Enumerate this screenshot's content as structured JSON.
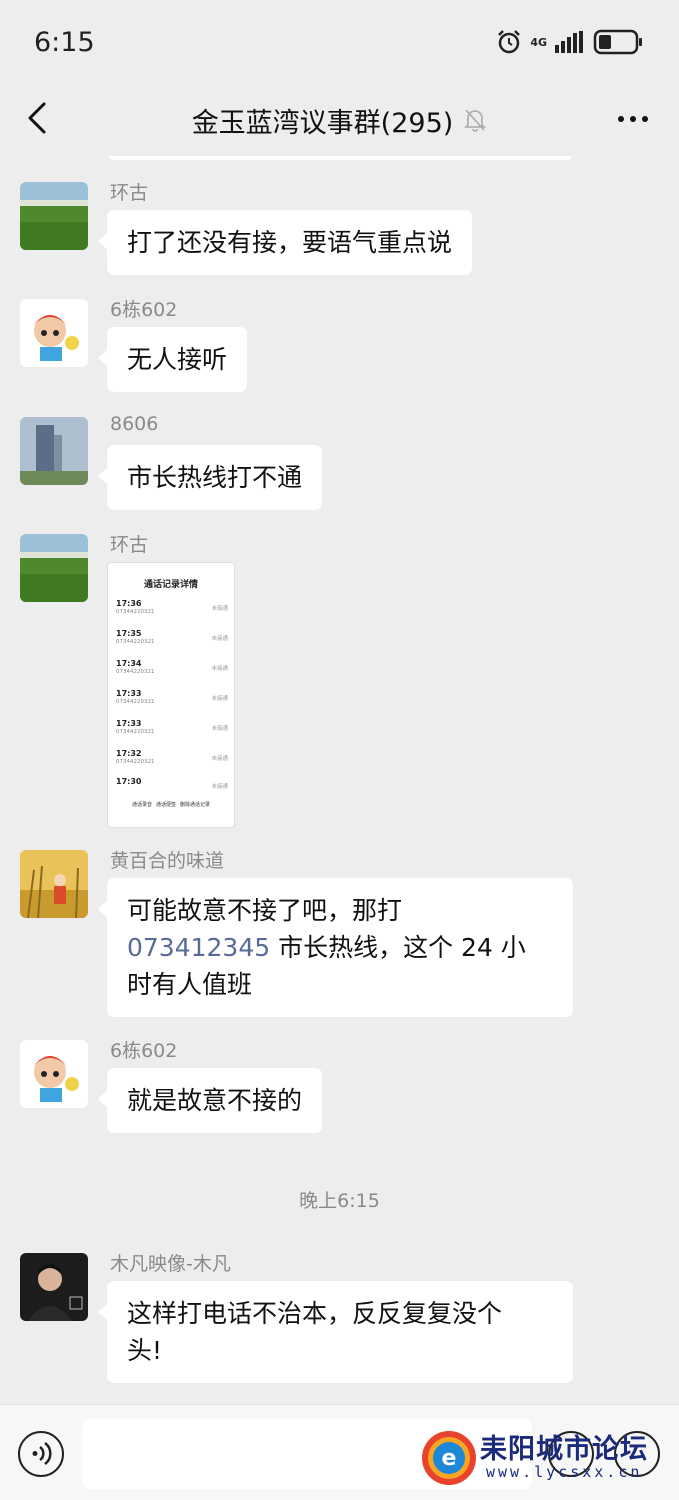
{
  "status": {
    "time": "6:15",
    "network": "4G"
  },
  "header": {
    "title": "金玉蓝湾议事群(295)"
  },
  "messages": [
    {
      "sender": "环古",
      "text": "打了还没有接，要语气重点说"
    },
    {
      "sender": "6栋602",
      "text": "无人接听"
    },
    {
      "sender": "8606",
      "text": "市长热线打不通"
    },
    {
      "sender": "环古",
      "image": {
        "title": "通话记录详情",
        "rows": [
          {
            "time": "17:36",
            "number": "07344220321",
            "status": "未接通"
          },
          {
            "time": "17:35",
            "number": "07344220321",
            "status": "未接通"
          },
          {
            "time": "17:34",
            "number": "07344220321",
            "status": "未接通"
          },
          {
            "time": "17:33",
            "number": "07344220321",
            "status": "未接通"
          },
          {
            "time": "17:33",
            "number": "07344220321",
            "status": "未接通"
          },
          {
            "time": "17:32",
            "number": "07344220321",
            "status": "未接通"
          },
          {
            "time": "17:30",
            "number": "",
            "status": "未接通"
          }
        ],
        "footer": [
          "通话录音",
          "通话便签",
          "删除通话记录"
        ]
      }
    },
    {
      "sender": "黄百合的味道",
      "text_line1": "可能故意不接了吧，那打",
      "link": "073412345",
      "text_line2": " 市长热线，这个 24 小",
      "text_line3": "时有人值班"
    },
    {
      "sender": "6栋602",
      "text": "就是故意不接的"
    },
    {
      "sender": "木凡映像-木凡",
      "text_line1": "这样打电话不治本，反反复复没个",
      "text_line2": "头!"
    }
  ],
  "time_divider": "晚上6:15",
  "watermark": {
    "text": "耒阳城市论坛",
    "url": "www.lycsxx.cn"
  },
  "colors": {
    "background": "#ededed",
    "bubble": "#ffffff",
    "link": "#576b95",
    "meta": "#8a8a8a"
  }
}
